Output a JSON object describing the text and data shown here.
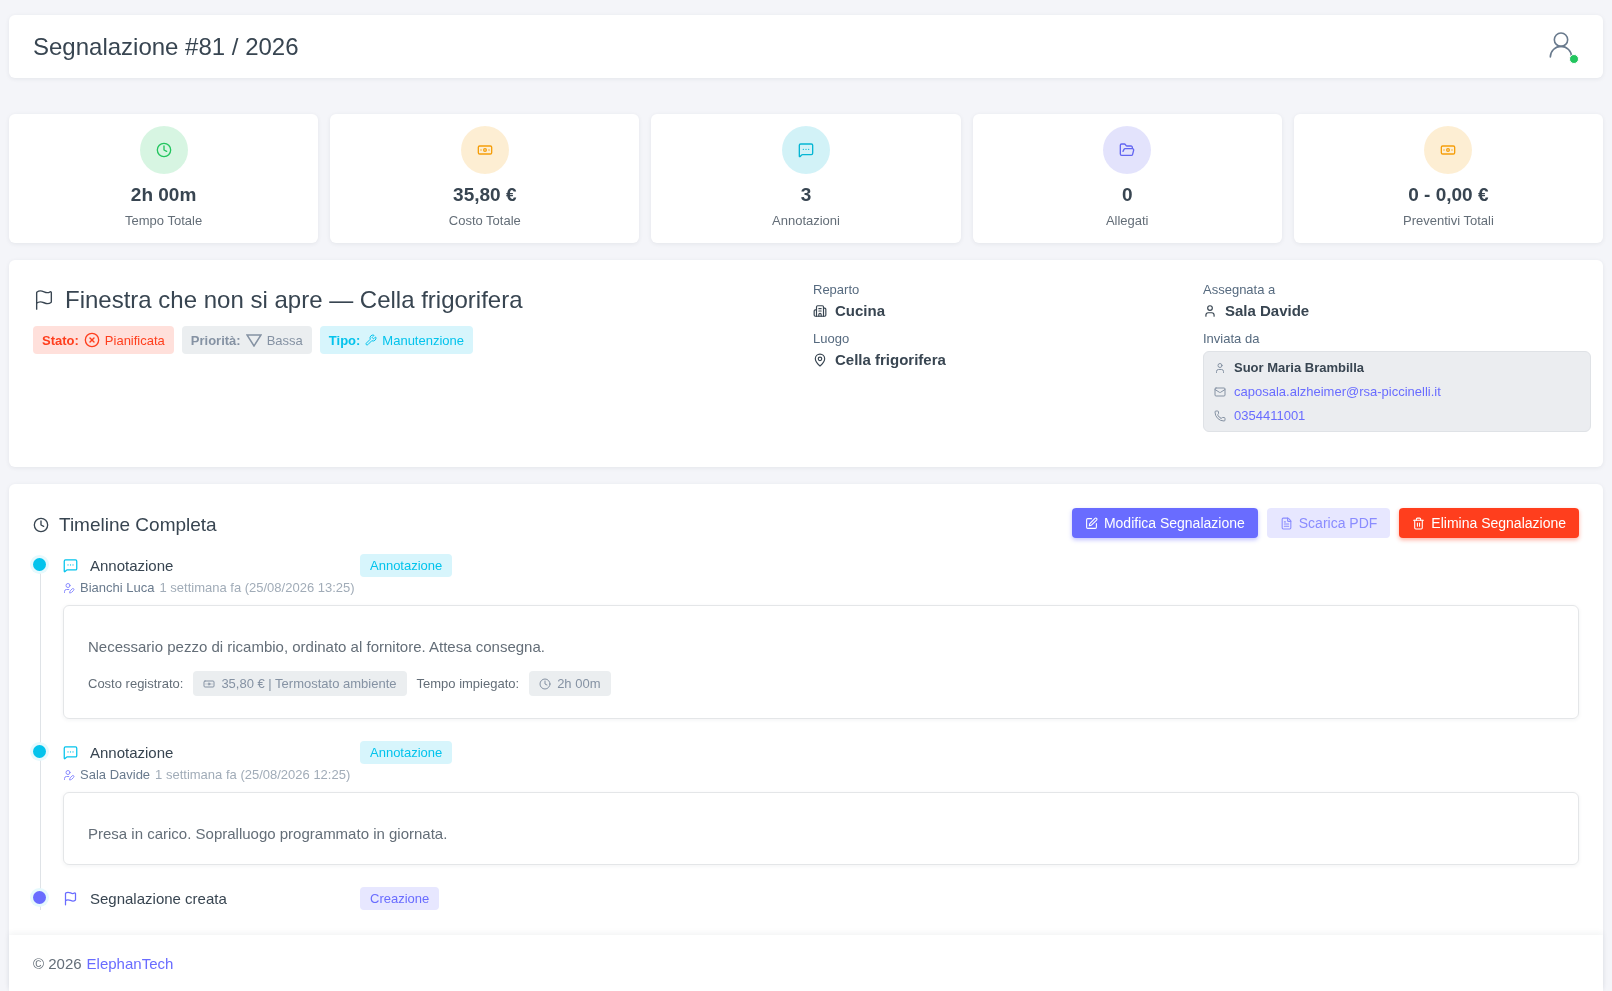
{
  "header": {
    "title": "Segnalazione #81 / 2026",
    "user_online": true
  },
  "stats": [
    {
      "kind": "clock",
      "color": "#22c55e",
      "value": "2h 00m",
      "label": "Tempo Totale"
    },
    {
      "kind": "money",
      "color": "#f59e0b",
      "value": "35,80 €",
      "label": "Costo Totale"
    },
    {
      "kind": "chat",
      "color": "#06b6d4",
      "value": "3",
      "label": "Annotazioni"
    },
    {
      "kind": "folder",
      "color": "#6366f1",
      "value": "0",
      "label": "Allegati"
    },
    {
      "kind": "money",
      "color": "#f59e0b",
      "value": "0 - 0,00 €",
      "label": "Preventivi Totali"
    }
  ],
  "ticket": {
    "title": "Finestra che non si apre — Cella frigorifera",
    "badges": [
      {
        "kind": "status",
        "label": "Stato:",
        "value": "Pianificata"
      },
      {
        "kind": "priority",
        "label": "Priorità:",
        "value": "Bassa"
      },
      {
        "kind": "type",
        "label": "Tipo:",
        "value": "Manutenzione"
      }
    ],
    "department": {
      "label": "Reparto",
      "value": "Cucina"
    },
    "place": {
      "label": "Luogo",
      "value": "Cella frigorifera"
    },
    "assigned": {
      "label": "Assegnata a",
      "value": "Sala Davide"
    },
    "sender": {
      "label": "Inviata da",
      "name": "Suor Maria Brambilla",
      "email": "caposala.alzheimer@rsa-piccinelli.it",
      "phone": "0354411001"
    }
  },
  "timeline": {
    "title": "Timeline Completa",
    "actions": [
      {
        "kind": "primary",
        "label": "Modifica Segnalazione"
      },
      {
        "kind": "secondary",
        "label": "Scarica PDF"
      },
      {
        "kind": "danger",
        "label": "Elimina Segnalazione"
      }
    ],
    "events": [
      {
        "kind": "annotation",
        "title": "Annotazione",
        "tag": "Annotazione",
        "author": "Bianchi Luca",
        "time": "1 settimana fa (25/08/2026 13:25)",
        "text": "Necessario pezzo di ricambio, ordinato al fornitore. Attesa consegna.",
        "cost_label": "Costo registrato:",
        "cost": "35,80 € | Termostato ambiente",
        "time_label": "Tempo impiegato:",
        "time_spent": "2h 00m"
      },
      {
        "kind": "annotation",
        "title": "Annotazione",
        "tag": "Annotazione",
        "author": "Sala Davide",
        "time": "1 settimana fa (25/08/2026 12:25)",
        "text": "Presa in carico. Sopralluogo programmato in giornata."
      },
      {
        "kind": "creation",
        "title": "Segnalazione creata",
        "tag": "Creazione"
      }
    ]
  },
  "footer": {
    "copyright": "© 2026",
    "brand": "ElephanTech"
  }
}
